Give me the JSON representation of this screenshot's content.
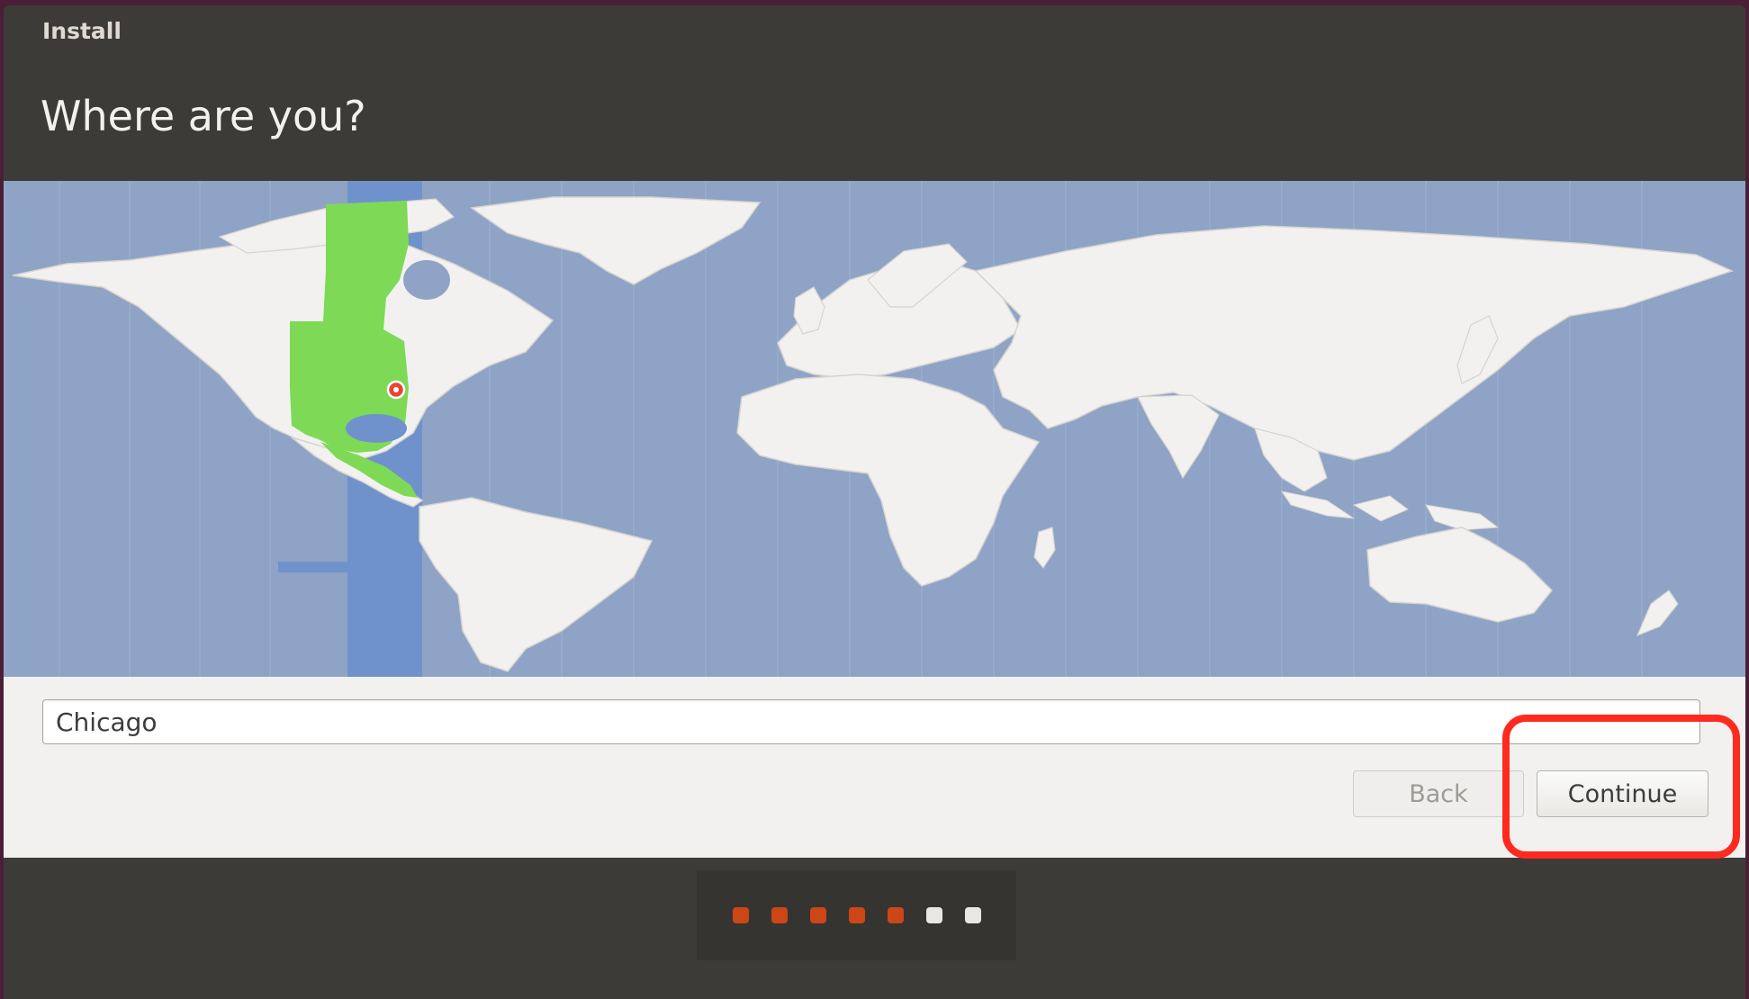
{
  "window": {
    "title": "Install"
  },
  "page": {
    "heading": "Where are you?"
  },
  "timezone_input": {
    "value": "Chicago"
  },
  "buttons": {
    "back_label": "Back",
    "continue_label": "Continue"
  },
  "map": {
    "selected_location": "Chicago",
    "colors": {
      "ocean": "#8ea3c6",
      "land": "#f2f1ef",
      "selected_zone_land": "#7ed957",
      "selected_zone_band": "#6f92cc",
      "marker": "#e8443a"
    }
  },
  "progress": {
    "total_steps": 7,
    "completed_steps": 5
  },
  "annotation": {
    "highlight_color": "#ff2a1f",
    "target": "continue-button"
  }
}
